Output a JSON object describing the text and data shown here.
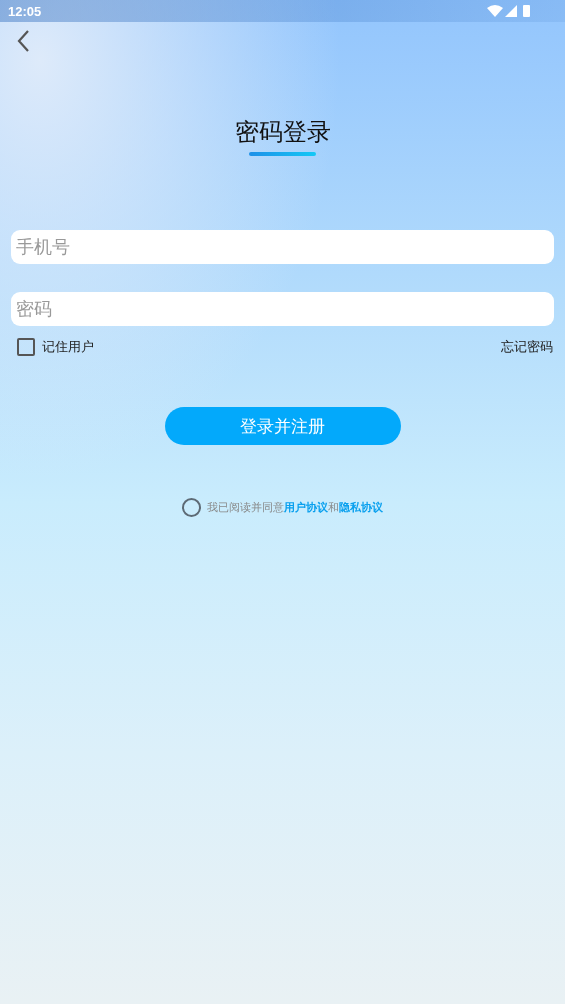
{
  "status_bar": {
    "time": "12:05"
  },
  "title": "密码登录",
  "fields": [
    {
      "placeholder": "手机号"
    },
    {
      "placeholder": "密码"
    }
  ],
  "remember": {
    "label": "记住用户",
    "checked": false
  },
  "forgot_link": "忘记密码",
  "submit_button": "登录并注册",
  "agreement": {
    "checked": false,
    "prefix": "我已阅读并同意",
    "link_1": "用户协议",
    "joiner": "和",
    "link_2": "隐私协议"
  }
}
